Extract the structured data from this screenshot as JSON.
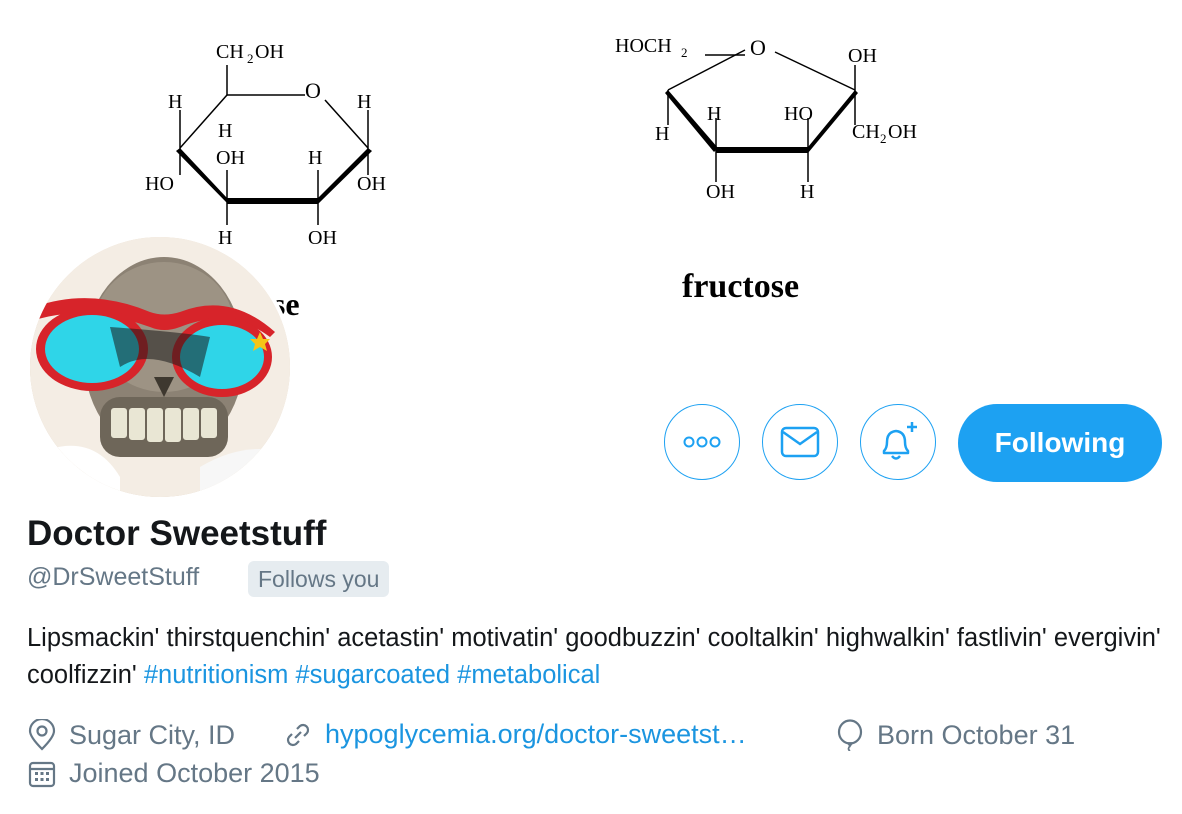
{
  "banner": {
    "structure_left_label": "H",
    "glucose_caption": "glucose",
    "fructose_caption": "fructose"
  },
  "profile": {
    "display_name": "Doctor Sweetstuff",
    "handle": "@DrSweetStuff",
    "follows_you_badge": "Follows you",
    "bio_text": "Lipsmackin' thirstquenchin' acetastin' motivatin' goodbuzzin' cooltalkin' highwalkin' fastlivin' evergivin' coolfizzin' ",
    "bio_hashtags": [
      "#nutritionism",
      "#sugarcoated",
      "#metabolical"
    ],
    "location": "Sugar City, ID",
    "website": "hypoglycemia.org/doctor-sweetst…",
    "birthday": "Born October 31",
    "joined": "Joined October 2015"
  },
  "actions": {
    "more_icon": "more-icon",
    "message_icon": "envelope-icon",
    "notify_icon": "bell-plus-icon",
    "following_label": "Following"
  },
  "colors": {
    "accent": "#1da1f2",
    "link": "#1b95e0",
    "secondary_text": "#657786",
    "badge_bg": "#e6ecf0"
  }
}
